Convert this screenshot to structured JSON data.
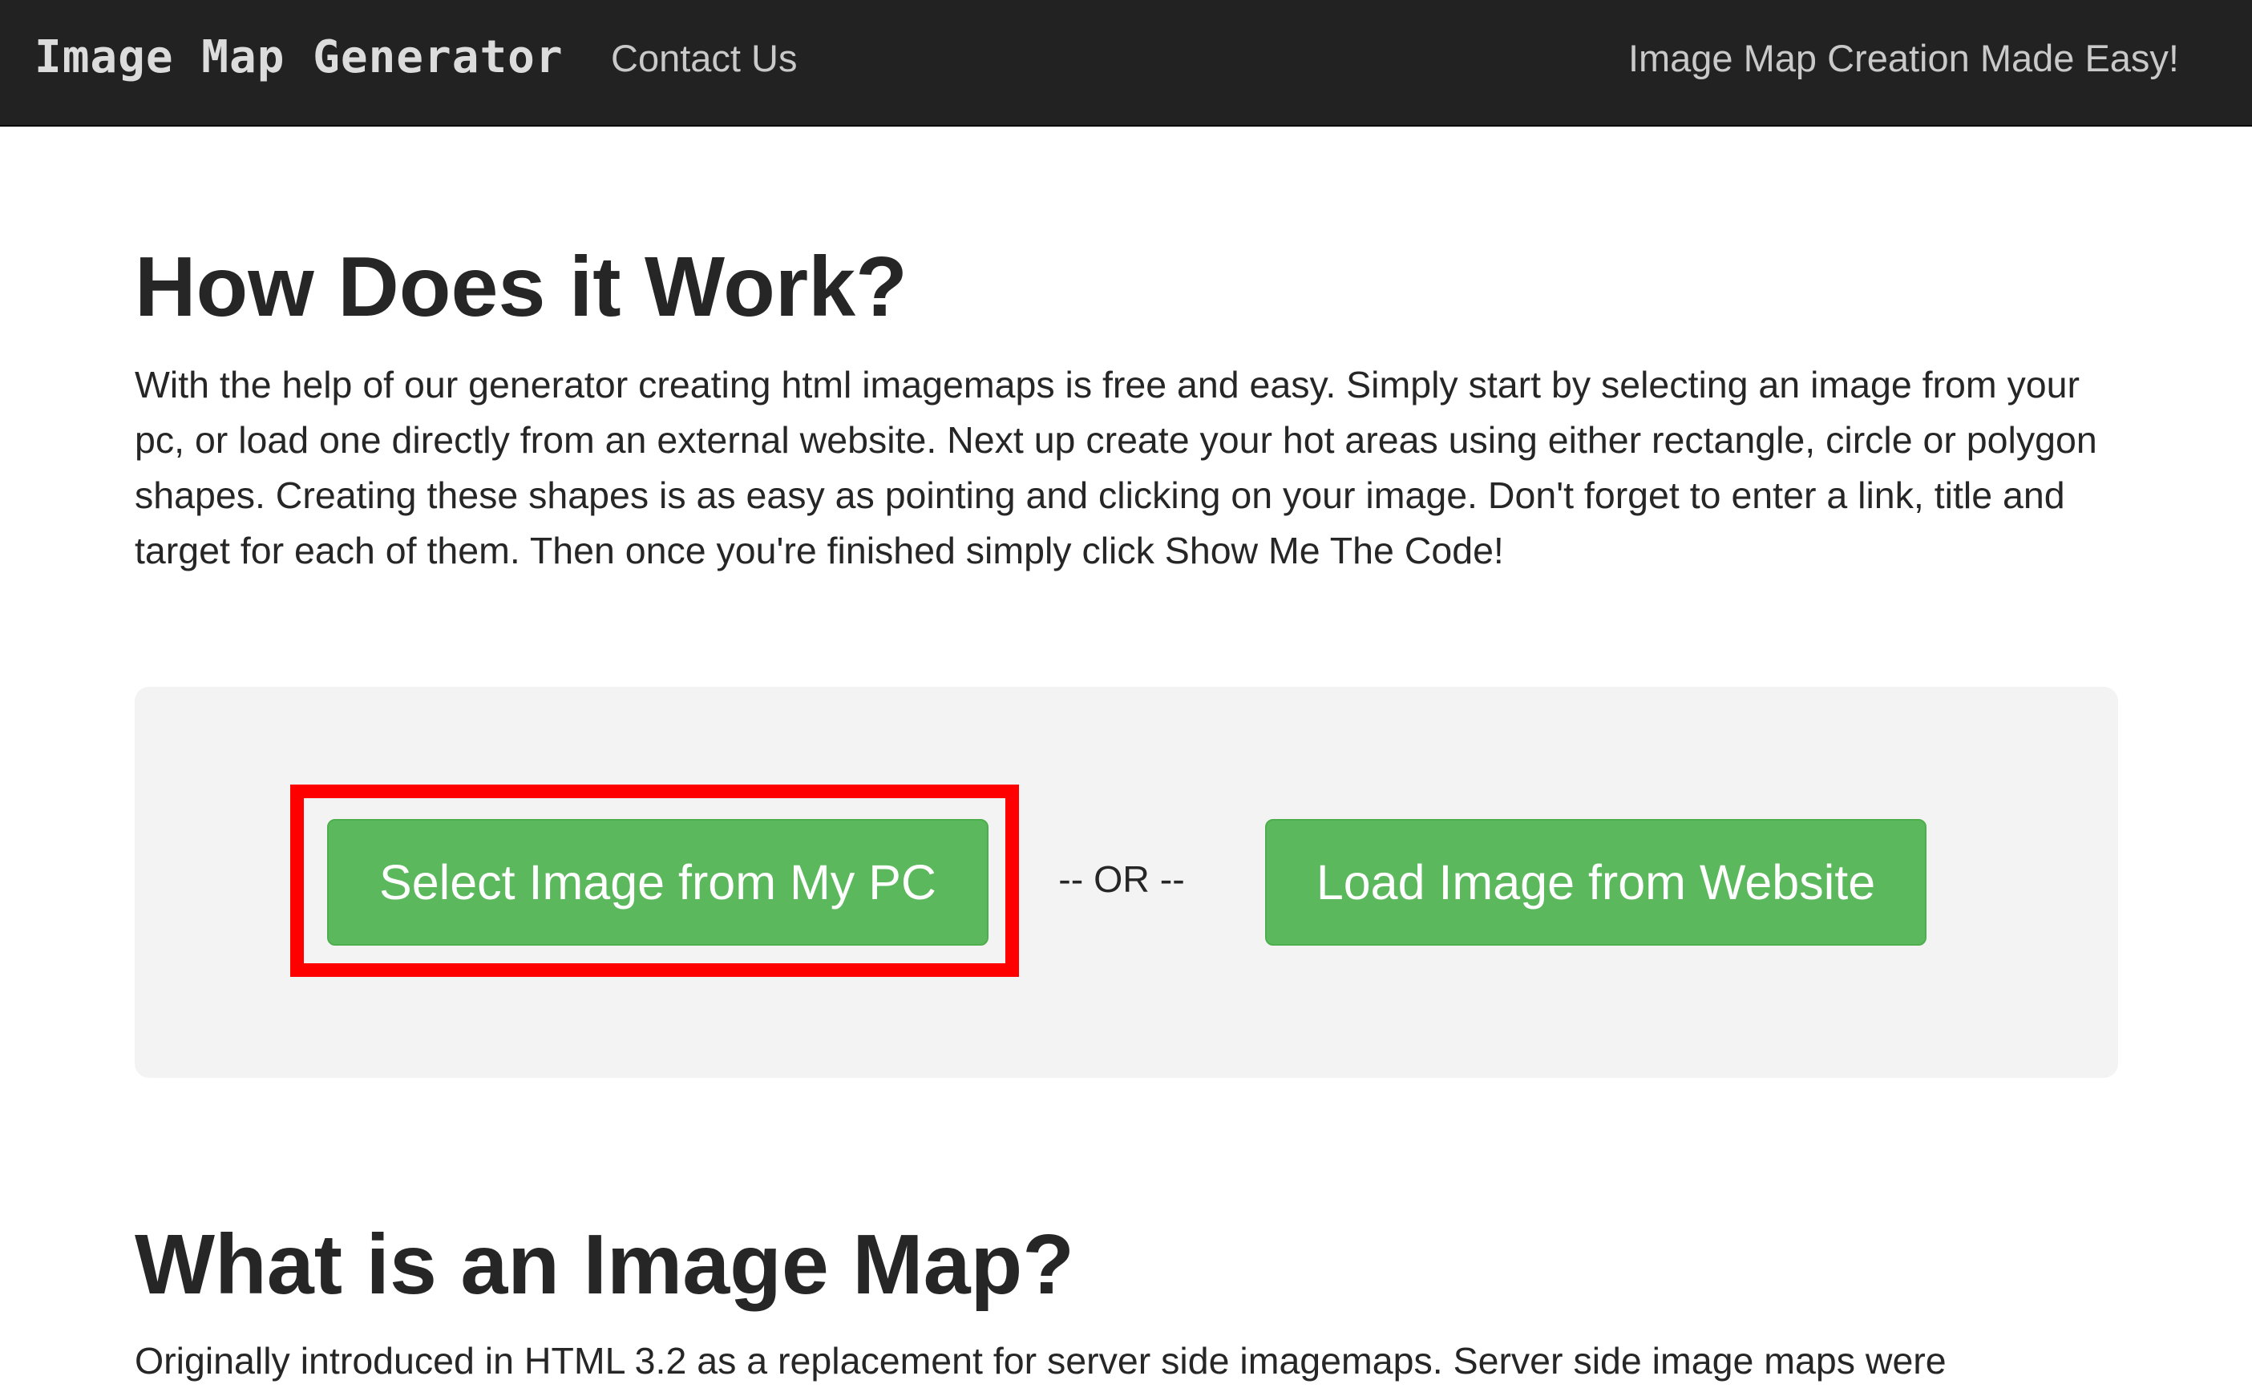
{
  "navbar": {
    "brand": "Image Map Generator",
    "contact_label": "Contact Us",
    "tagline": "Image Map Creation Made Easy!"
  },
  "how_section": {
    "heading": "How Does it Work?",
    "paragraph": "With the help of our generator creating html imagemaps is free and easy. Simply start by selecting an image from your pc, or load one directly from an external website. Next up create your hot areas using either rectangle, circle or polygon shapes. Creating these shapes is as easy as pointing and clicking on your image. Don't forget to enter a link, title and target for each of them. Then once you're finished simply click Show Me The Code!"
  },
  "upload_panel": {
    "select_button": "Select Image from My PC",
    "or_separator": "-- OR --",
    "load_button": "Load Image from Website"
  },
  "what_section": {
    "heading": "What is an Image Map?",
    "paragraph": "Originally introduced in HTML 3.2 as a replacement for server side imagemaps. Server side image maps were"
  },
  "colors": {
    "navbar_bg": "#222222",
    "button_green": "#5cb85c",
    "highlight_red": "#ff0000",
    "panel_bg": "#f3f3f3"
  }
}
